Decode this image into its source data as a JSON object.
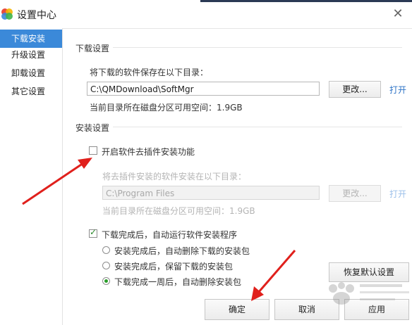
{
  "window": {
    "title": "设置中心",
    "close_glyph": "✕"
  },
  "sidebar": {
    "items": [
      {
        "label": "下载安装",
        "active": true
      },
      {
        "label": "升级设置",
        "active": false
      },
      {
        "label": "卸载设置",
        "active": false
      },
      {
        "label": "其它设置",
        "active": false
      }
    ]
  },
  "download": {
    "section_title": "下载设置",
    "save_label": "将下载的软件保存在以下目录：",
    "path": "C:\\QMDownload\\SoftMgr",
    "change_label": "更改...",
    "open_label": "打开",
    "space_text": "当前目录所在磁盘分区可用空间：1.9GB"
  },
  "install": {
    "section_title": "安装设置",
    "plugin_checkbox_label": "开启软件去插件安装功能",
    "plugin_checked": false,
    "plugin_dir_label": "将去插件安装的软件安装在以下目录：",
    "plugin_path": "C:\\Program Files",
    "change_label": "更改...",
    "open_label": "打开",
    "space_text": "当前目录所在磁盘分区可用空间：1.9GB",
    "auto_install_label": "下载完成后，自动运行软件安装程序",
    "auto_install_checked": true,
    "options": [
      {
        "label": "安装完成后，自动删除下载的安装包",
        "selected": false
      },
      {
        "label": "安装完成后，保留下载的安装包",
        "selected": false
      },
      {
        "label": "下载完成一周后，自动删除安装包",
        "selected": true
      }
    ],
    "restore_label": "恢复默认设置"
  },
  "footer": {
    "ok_label": "确定",
    "cancel_label": "取消",
    "apply_label": "应用"
  },
  "colors": {
    "accent": "#3b89d9",
    "link": "#2d73c6",
    "arrow": "#e0201c"
  }
}
